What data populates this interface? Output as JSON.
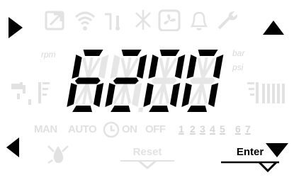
{
  "display": {
    "digits": [
      "6",
      "2",
      "0",
      "0"
    ],
    "units_left": "rpm",
    "units_right_top": "bar",
    "units_right_bottom": "psi"
  },
  "status_icons": [
    "external-link-icon",
    "wifi-icon",
    "flame-thermo-icon",
    "antifreeze-icon",
    "fan-icon",
    "bell-icon",
    "wrench-icon"
  ],
  "modes": {
    "man": "MAN",
    "auto": "AUTO",
    "on": "ON",
    "off": "OFF"
  },
  "days": [
    "1",
    "2",
    "3",
    "4",
    "5",
    "6",
    "7"
  ],
  "buttons": {
    "reset": "Reset",
    "enter": "Enter"
  },
  "colors": {
    "active": "#000000",
    "inactive": "#e2e2e2",
    "segment_off": "#e6e6e6"
  }
}
